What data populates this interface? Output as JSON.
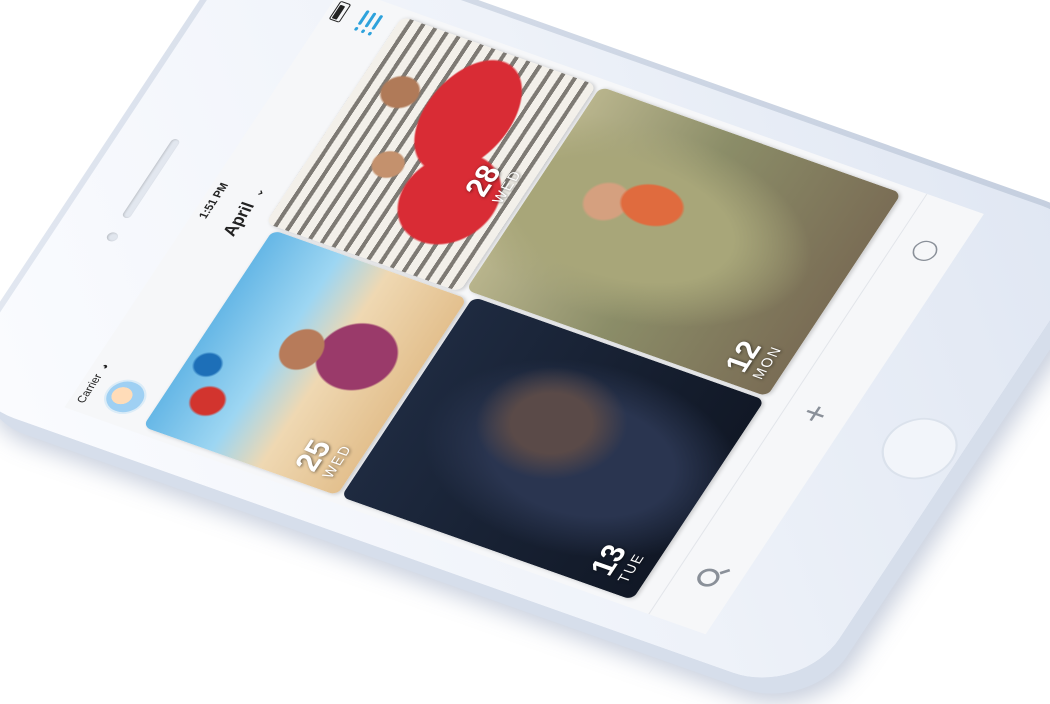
{
  "status_bar": {
    "carrier": "Carrier",
    "time": "1:51 PM"
  },
  "nav": {
    "month": "April",
    "menu_icon": "list-icon",
    "avatar_icon": "avatar"
  },
  "photos": [
    {
      "day": "25",
      "weekday": "WED"
    },
    {
      "day": "28",
      "weekday": "WED"
    },
    {
      "day": "13",
      "weekday": "TUE"
    },
    {
      "day": "12",
      "weekday": "MON"
    }
  ],
  "tabs": [
    {
      "icon": "search-icon"
    },
    {
      "icon": "plus-icon",
      "glyph": "+"
    },
    {
      "icon": "profile-icon"
    }
  ],
  "colors": {
    "accent": "#2ea2dc",
    "phone_body": "#eef2f9"
  }
}
